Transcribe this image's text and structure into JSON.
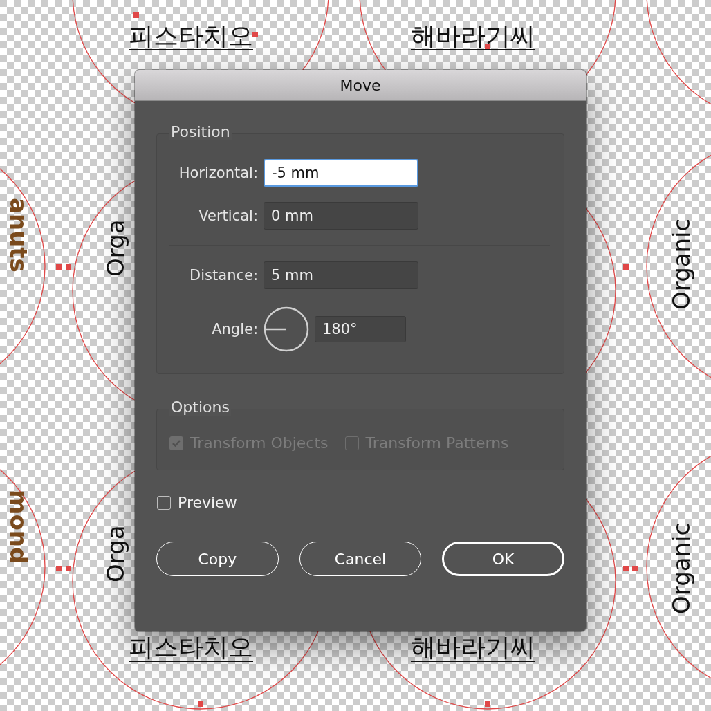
{
  "canvas": {
    "labels": [
      {
        "text": "피스타치오",
        "kind": "hangul"
      },
      {
        "text": "해바라기씨",
        "kind": "hangul"
      },
      {
        "text": "Orga",
        "kind": "vertical-up"
      },
      {
        "text": "Organic",
        "kind": "vertical-up"
      },
      {
        "text": "anuts",
        "kind": "vertical-down"
      },
      {
        "text": "Orga",
        "kind": "vertical-up"
      },
      {
        "text": "Organic",
        "kind": "vertical-up"
      },
      {
        "text": "mond",
        "kind": "vertical-down"
      },
      {
        "text": "피스타치오",
        "kind": "hangul"
      },
      {
        "text": "해바라기씨",
        "kind": "hangul"
      }
    ]
  },
  "dialog": {
    "title": "Move",
    "position": {
      "legend": "Position",
      "fields": [
        {
          "label": "Horizontal:",
          "value": "-5 mm",
          "focused": true
        },
        {
          "label": "Vertical:",
          "value": "0 mm",
          "focused": false
        }
      ],
      "distance": {
        "label": "Distance:",
        "value": "5 mm"
      },
      "angle": {
        "label": "Angle:",
        "value": "180°"
      }
    },
    "options": {
      "legend": "Options",
      "disabled": true,
      "checkboxes": [
        {
          "label": "Transform Objects",
          "checked": true
        },
        {
          "label": "Transform Patterns",
          "checked": false
        }
      ]
    },
    "preview": {
      "label": "Preview",
      "checked": false
    },
    "buttons": [
      {
        "label": "Copy",
        "default": false
      },
      {
        "label": "Cancel",
        "default": false
      },
      {
        "label": "OK",
        "default": true
      }
    ]
  }
}
